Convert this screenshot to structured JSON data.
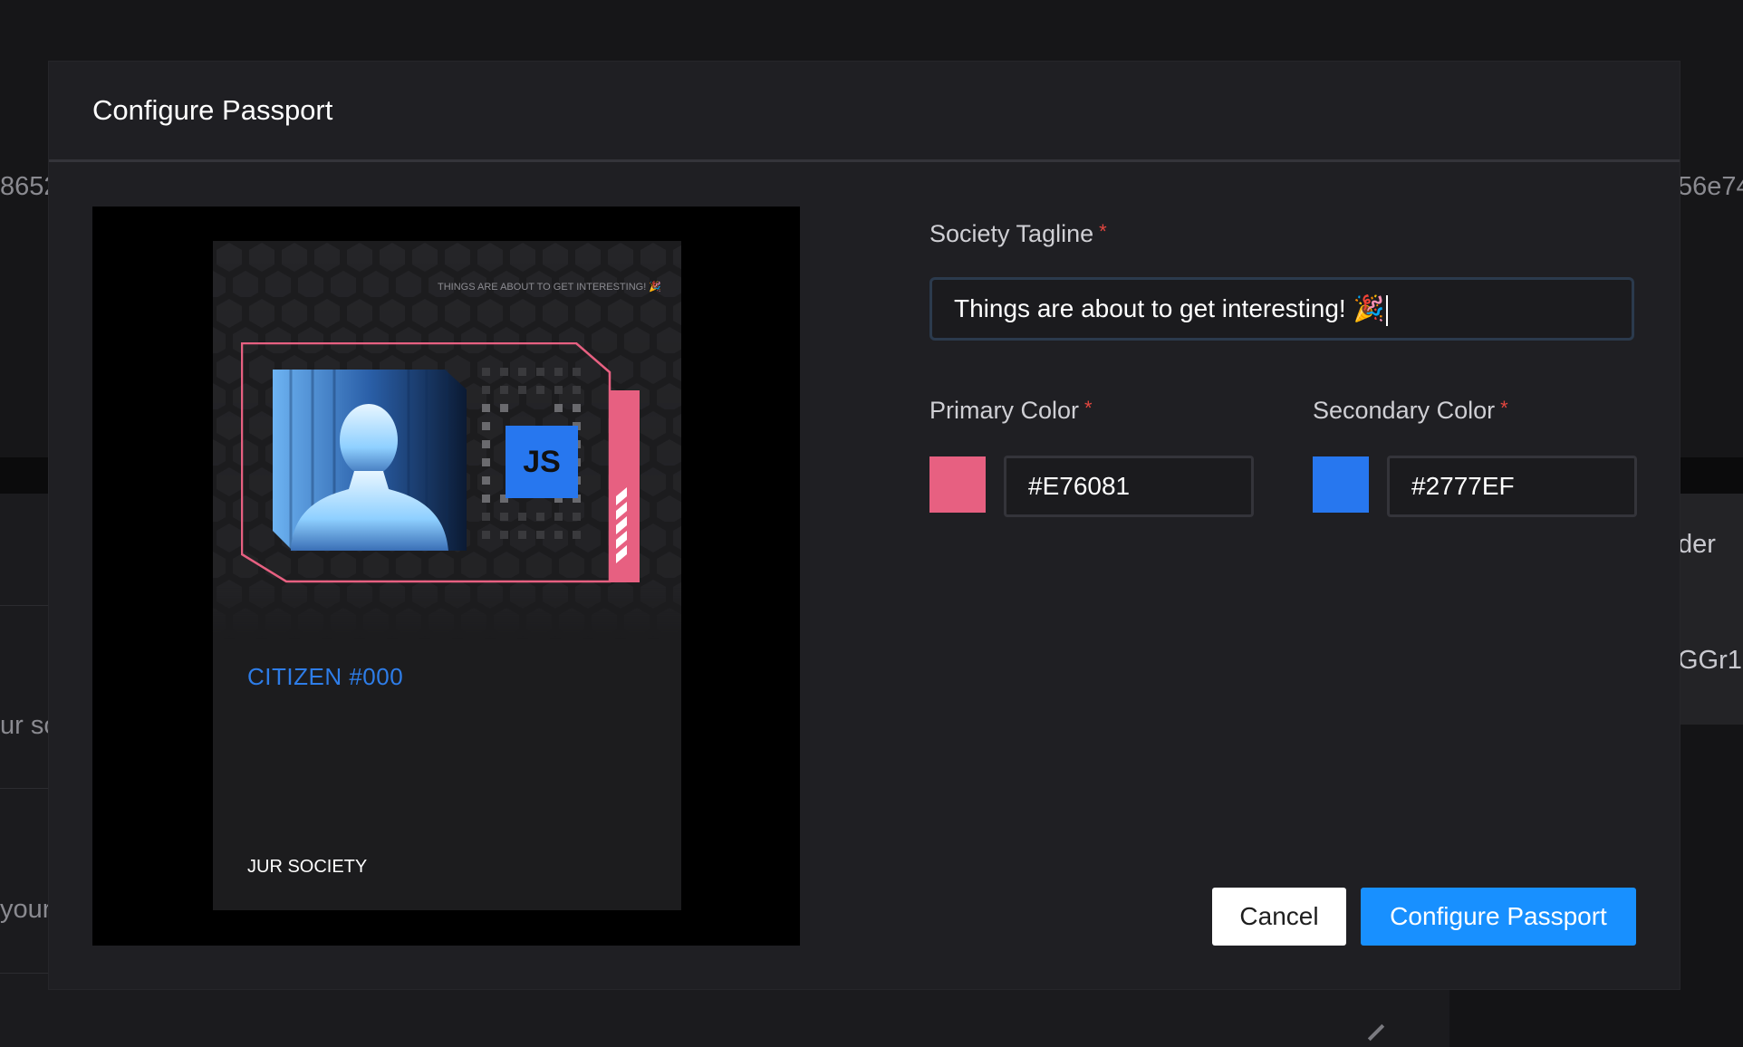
{
  "background": {
    "left_top_text": "8652",
    "right_top_text": "56e74",
    "right_mid_text": "der",
    "right_row_text": "GGr1",
    "left_mid_text": "ur so",
    "left_low_text": "your"
  },
  "modal": {
    "title": "Configure Passport",
    "preview": {
      "tagline": "THINGS ARE ABOUT TO GET INTERESTING! 🎉",
      "badge": "JS",
      "citizen": "CITIZEN #000",
      "society": "JUR SOCIETY"
    },
    "form": {
      "tagline_label": "Society Tagline",
      "tagline_value": "Things are about to get interesting! 🎉",
      "primary_label": "Primary Color",
      "primary_value": "#E76081",
      "secondary_label": "Secondary Color",
      "secondary_value": "#2777EF",
      "required_mark": "*"
    },
    "buttons": {
      "cancel": "Cancel",
      "submit": "Configure Passport"
    }
  },
  "colors": {
    "primary": "#E76081",
    "secondary": "#2777EF",
    "accent_button": "#1890FF"
  }
}
